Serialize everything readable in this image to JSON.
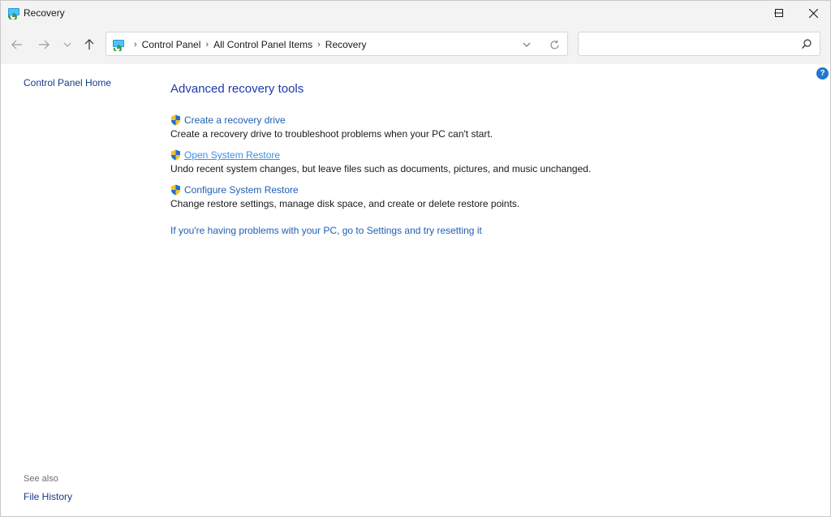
{
  "window": {
    "title": "Recovery"
  },
  "navigation": {
    "breadcrumbs": [
      "Control Panel",
      "All Control Panel Items",
      "Recovery"
    ],
    "search_placeholder": ""
  },
  "left_pane": {
    "home_link": "Control Panel Home",
    "see_also_label": "See also",
    "see_also_links": [
      "File History"
    ]
  },
  "main": {
    "heading": "Advanced recovery tools",
    "items": [
      {
        "link": "Create a recovery drive",
        "description": "Create a recovery drive to troubleshoot problems when your PC can't start."
      },
      {
        "link": "Open System Restore",
        "description": "Undo recent system changes, but leave files such as documents, pictures, and music unchanged."
      },
      {
        "link": "Configure System Restore",
        "description": "Change restore settings, manage disk space, and create or delete restore points."
      }
    ],
    "reset_link": "If you're having problems with your PC, go to Settings and try resetting it"
  },
  "help": {
    "glyph": "?"
  },
  "colors": {
    "link": "#1f5fb4",
    "heading": "#1e3aa8",
    "chrome": "#f3f3f3",
    "help": "#1e78d2"
  }
}
